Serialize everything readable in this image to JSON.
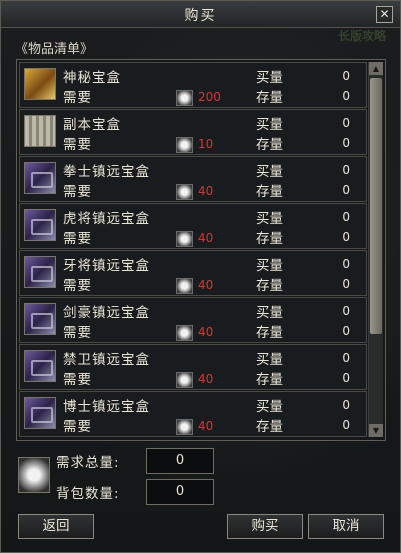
{
  "window": {
    "title": "购买",
    "close_glyph": "✕"
  },
  "background_text": "长版攻略",
  "section_title": "《物品清单》",
  "labels": {
    "need": "需要",
    "buy_qty": "买量",
    "stock_qty": "存量"
  },
  "items": [
    {
      "name": "神秘宝盒",
      "icon": "gold-treasure-icon",
      "cost": "200",
      "buy": "0",
      "stock": "0"
    },
    {
      "name": "副本宝盒",
      "icon": "white-chest-icon",
      "cost": "10",
      "buy": "0",
      "stock": "0"
    },
    {
      "name": "拳士镇远宝盒",
      "icon": "purple-chest-icon",
      "cost": "40",
      "buy": "0",
      "stock": "0"
    },
    {
      "name": "虎将镇远宝盒",
      "icon": "purple-chest-icon",
      "cost": "40",
      "buy": "0",
      "stock": "0"
    },
    {
      "name": "牙将镇远宝盒",
      "icon": "purple-chest-icon",
      "cost": "40",
      "buy": "0",
      "stock": "0"
    },
    {
      "name": "剑豪镇远宝盒",
      "icon": "purple-chest-icon",
      "cost": "40",
      "buy": "0",
      "stock": "0"
    },
    {
      "name": "禁卫镇远宝盒",
      "icon": "purple-chest-icon",
      "cost": "40",
      "buy": "0",
      "stock": "0"
    },
    {
      "name": "博士镇远宝盒",
      "icon": "purple-chest-icon",
      "cost": "40",
      "buy": "0",
      "stock": "0"
    }
  ],
  "summary": {
    "total_label": "需求总量:",
    "total_value": "0",
    "bag_label": "背包数量:",
    "bag_value": "0"
  },
  "buttons": {
    "back": "返回",
    "buy": "购买",
    "cancel": "取消"
  },
  "colors": {
    "cost": "#e0322e",
    "text": "#ebe5d4",
    "frame": "#615e55"
  }
}
